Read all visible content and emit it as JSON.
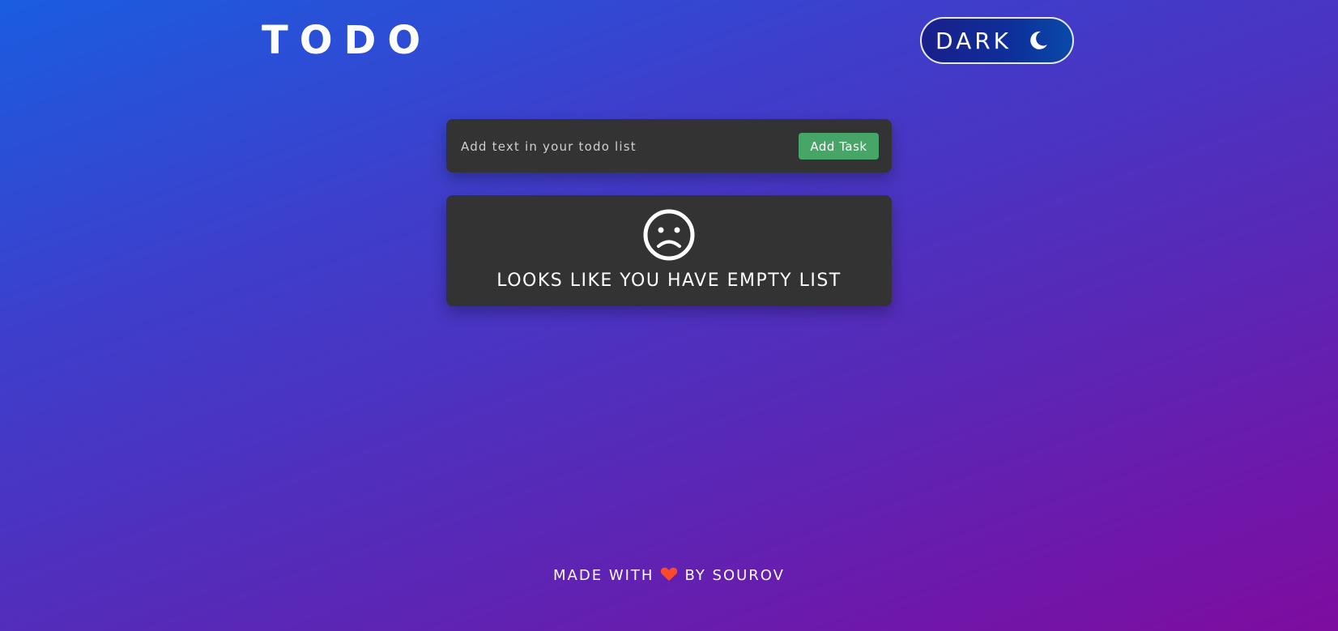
{
  "header": {
    "title": "TODO",
    "theme_toggle_label": "DARK",
    "theme_icon": "moon-icon"
  },
  "add_task": {
    "input_value": "",
    "input_placeholder": "Add text in your todo list",
    "button_label": "Add Task"
  },
  "empty_state": {
    "icon": "sad-face-icon",
    "message": "LOOKS LIKE YOU HAVE EMPTY LIST"
  },
  "footer": {
    "prefix": "MADE WITH",
    "icon": "heart-icon",
    "suffix": "BY SOUROV"
  },
  "colors": {
    "background_start": "#1a5de0",
    "background_end": "#7e0ca0",
    "card": "#333333",
    "button_green": "#47a667",
    "heart_red": "#ff4a2a",
    "toggle_bg": "#0d2f9a"
  }
}
